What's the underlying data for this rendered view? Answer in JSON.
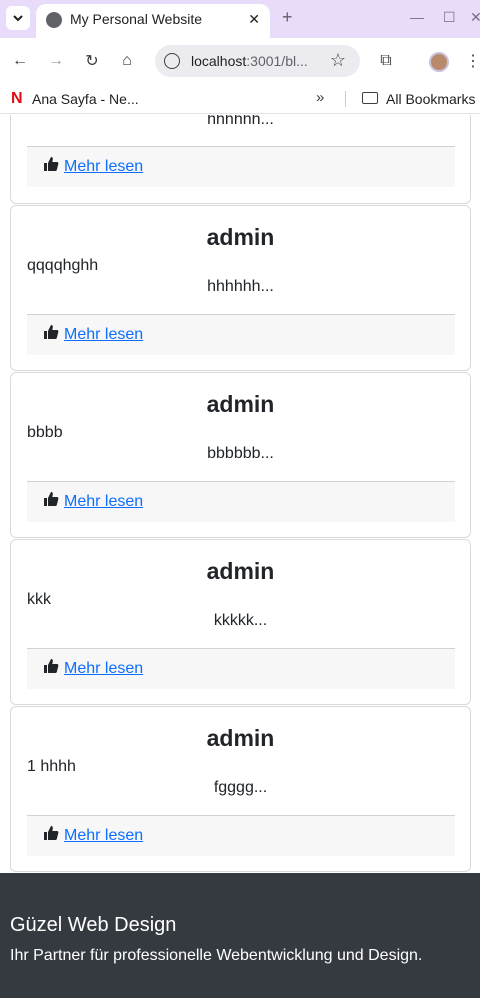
{
  "browser": {
    "tab_title": "My Personal Website",
    "url_host": "localhost",
    "url_rest": ":3001/bl...",
    "bookmark_label": "Ana Sayfa - Ne...",
    "all_bookmarks": "All Bookmarks"
  },
  "posts_partial": {
    "excerpt": "hhhhhh...",
    "more_label": "Mehr lesen"
  },
  "posts": [
    {
      "author": "admin",
      "title": "qqqqhghh",
      "excerpt": "hhhhhh...",
      "more_label": "Mehr lesen"
    },
    {
      "author": "admin",
      "title": "bbbb",
      "excerpt": "bbbbbb...",
      "more_label": "Mehr lesen"
    },
    {
      "author": "admin",
      "title": "kkk",
      "excerpt": "kkkkk...",
      "more_label": "Mehr lesen"
    },
    {
      "author": "admin",
      "title": "1 hhhh",
      "excerpt": "fgggg...",
      "more_label": "Mehr lesen"
    }
  ],
  "footer": {
    "brand": "Güzel Web Design",
    "tagline": "Ihr Partner für professionelle Webentwicklung und Design."
  },
  "colors": {
    "link": "#0d6efd",
    "footer_bg": "#343a40",
    "tab_strip": "#e9dcfb"
  }
}
